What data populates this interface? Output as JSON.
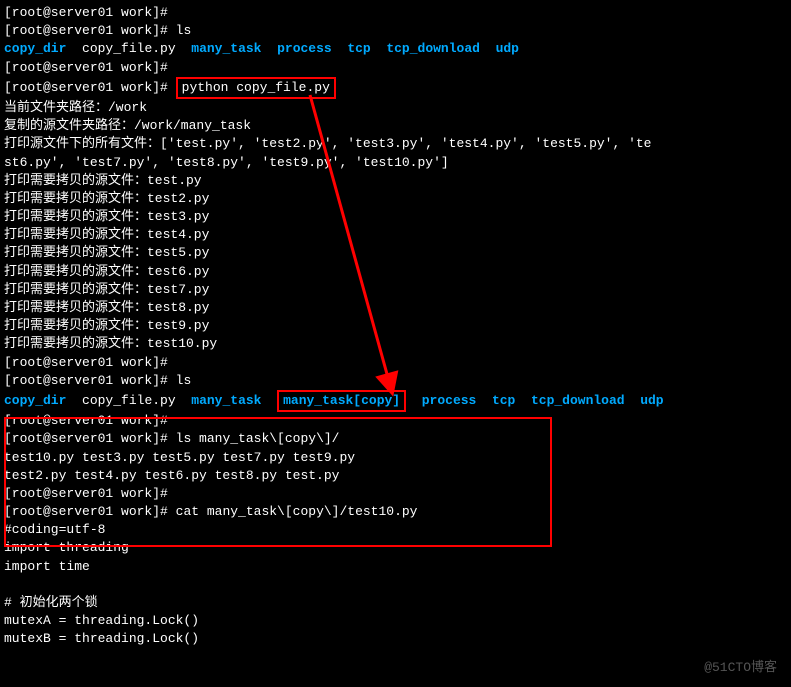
{
  "prompt": "[root@server01 work]#",
  "prompt_no_cmd": "[root@server01 work]#",
  "cmds": {
    "ls1": "ls",
    "python": "python copy_file.py",
    "ls2": "ls",
    "ls3": "ls many_task\\[copy\\]/",
    "cat": "cat many_task\\[copy\\]/test10.py"
  },
  "ls_output1": {
    "items": [
      "copy_dir",
      "copy_file.py",
      "many_task",
      "process",
      "tcp",
      "tcp_download",
      "udp"
    ]
  },
  "ls_output2": {
    "items": [
      "copy_dir",
      "copy_file.py",
      "many_task",
      "many_task[copy]",
      "process",
      "tcp",
      "tcp_download",
      "udp"
    ]
  },
  "python_output": {
    "l1": "当前文件夹路径：/work",
    "l2": "复制的源文件夹路径：/work/many_task",
    "l3": "打印源文件下的所有文件：['test.py', 'test2.py', 'test3.py', 'test4.py', 'test5.py', 'te",
    "l3b": "st6.py', 'test7.py', 'test8.py', 'test9.py', 'test10.py']",
    "copy_lines": [
      "打印需要拷贝的源文件：test.py",
      "打印需要拷贝的源文件：test2.py",
      "打印需要拷贝的源文件：test3.py",
      "打印需要拷贝的源文件：test4.py",
      "打印需要拷贝的源文件：test5.py",
      "打印需要拷贝的源文件：test6.py",
      "打印需要拷贝的源文件：test7.py",
      "打印需要拷贝的源文件：test8.py",
      "打印需要拷贝的源文件：test9.py",
      "打印需要拷贝的源文件：test10.py"
    ]
  },
  "ls_copy_output": {
    "row1": "test10.py  test3.py  test5.py  test7.py  test9.py",
    "row2": "test2.py   test4.py  test6.py  test8.py  test.py"
  },
  "cat_output": {
    "l1": "#coding=utf-8",
    "l2": "import threading",
    "l3": "import time",
    "l4": "",
    "l5": "# 初始化两个锁",
    "l6": "mutexA = threading.Lock()",
    "l7": "mutexB = threading.Lock()"
  },
  "watermark": "@51CTO博客"
}
